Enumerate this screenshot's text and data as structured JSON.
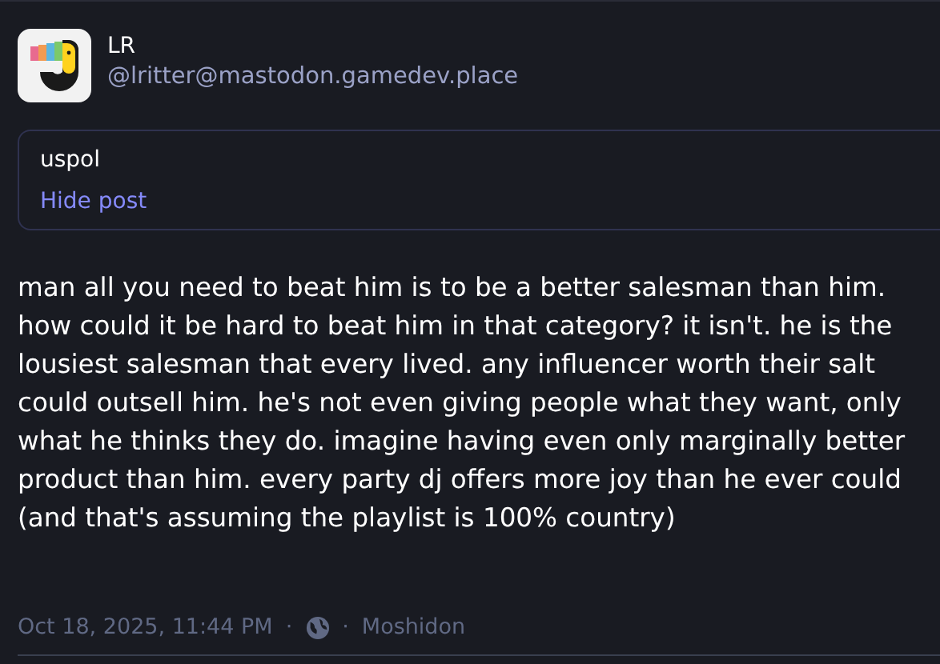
{
  "author": {
    "display_name": "LR",
    "handle": "@lritter@mastodon.gamedev.place"
  },
  "content_warning": {
    "text": "uspol",
    "toggle": "Hide post",
    "expanded": true
  },
  "body": "man all you need to beat him is to be a better salesman than him. how could it be hard to beat him in that category? it isn't. he is the lousiest salesman that every lived. any influencer worth their salt could outsell him. he's not even giving people what they want, only what he thinks they do. imagine having even only marginally better product than him. every party dj offers more joy than he ever could (and that's assuming the playlist is 100% country)",
  "footer": {
    "timestamp": "Oct 18, 2025, 11:44 PM",
    "separator_1": "·",
    "separator_2": "·",
    "application": "Moshidon"
  }
}
